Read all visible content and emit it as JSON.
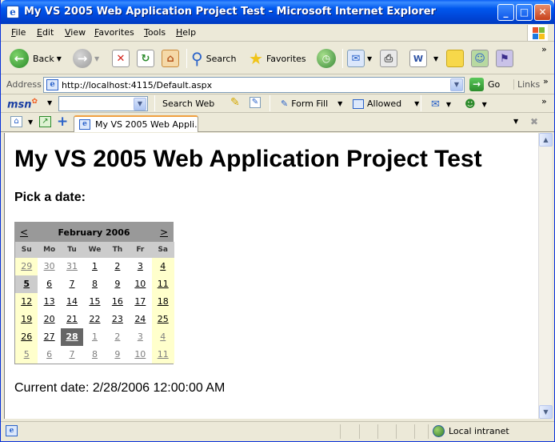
{
  "window": {
    "title": "My VS 2005 Web Application Project Test - Microsoft Internet Explorer",
    "minimize": "_",
    "maximize": "□",
    "close": "✕"
  },
  "menu": [
    {
      "key": "F",
      "rest": "ile"
    },
    {
      "key": "E",
      "rest": "dit"
    },
    {
      "key": "V",
      "rest": "iew"
    },
    {
      "key": "F",
      "rest": "avorites",
      "prefix": ""
    },
    {
      "key": "T",
      "rest": "ools"
    },
    {
      "key": "H",
      "rest": "elp"
    }
  ],
  "toolbar": {
    "back": "Back",
    "search": "Search",
    "favorites": "Favorites",
    "more": "»"
  },
  "address": {
    "label": "Address",
    "url": "http://localhost:4115/Default.aspx",
    "go": "Go",
    "links": "Links",
    "links_more": "»"
  },
  "msn": {
    "logo": "msn",
    "search_web": "Search Web",
    "form_fill": "Form Fill",
    "allowed": "Allowed",
    "more": "»"
  },
  "tab": {
    "label": "My VS 2005 Web Appli..."
  },
  "page": {
    "heading": "My VS 2005 Web Application Project Test",
    "pick_label": "Pick a date:",
    "current_date": "Current date: 2/28/2006 12:00:00 AM"
  },
  "calendar": {
    "prev": "<",
    "next": ">",
    "month": "February 2006",
    "days_of_week": [
      "Su",
      "Mo",
      "Tu",
      "We",
      "Th",
      "Fr",
      "Sa"
    ],
    "weeks": [
      [
        {
          "d": "29",
          "o": true
        },
        {
          "d": "30",
          "o": true
        },
        {
          "d": "31",
          "o": true
        },
        {
          "d": "1"
        },
        {
          "d": "2"
        },
        {
          "d": "3"
        },
        {
          "d": "4"
        }
      ],
      [
        {
          "d": "5",
          "t": true
        },
        {
          "d": "6"
        },
        {
          "d": "7"
        },
        {
          "d": "8"
        },
        {
          "d": "9"
        },
        {
          "d": "10"
        },
        {
          "d": "11"
        }
      ],
      [
        {
          "d": "12"
        },
        {
          "d": "13"
        },
        {
          "d": "14"
        },
        {
          "d": "15"
        },
        {
          "d": "16"
        },
        {
          "d": "17"
        },
        {
          "d": "18"
        }
      ],
      [
        {
          "d": "19"
        },
        {
          "d": "20"
        },
        {
          "d": "21"
        },
        {
          "d": "22"
        },
        {
          "d": "23"
        },
        {
          "d": "24"
        },
        {
          "d": "25"
        }
      ],
      [
        {
          "d": "26"
        },
        {
          "d": "27"
        },
        {
          "d": "28",
          "s": true
        },
        {
          "d": "1",
          "o": true
        },
        {
          "d": "2",
          "o": true
        },
        {
          "d": "3",
          "o": true
        },
        {
          "d": "4",
          "o": true
        }
      ],
      [
        {
          "d": "5",
          "o": true
        },
        {
          "d": "6",
          "o": true
        },
        {
          "d": "7",
          "o": true
        },
        {
          "d": "8",
          "o": true
        },
        {
          "d": "9",
          "o": true
        },
        {
          "d": "10",
          "o": true
        },
        {
          "d": "11",
          "o": true
        }
      ]
    ]
  },
  "status": {
    "zone": "Local intranet"
  }
}
